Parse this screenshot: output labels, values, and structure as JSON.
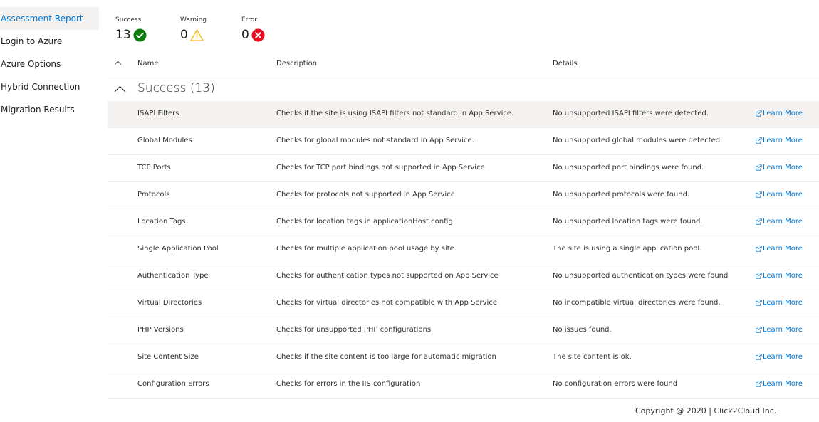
{
  "sidebar": {
    "items": [
      {
        "label": "Assessment Report",
        "active": true
      },
      {
        "label": "Login to Azure",
        "active": false
      },
      {
        "label": "Azure Options",
        "active": false
      },
      {
        "label": "Hybrid Connection",
        "active": false
      },
      {
        "label": "Migration Results",
        "active": false
      }
    ]
  },
  "summary": {
    "success": {
      "label": "Success",
      "count": "13",
      "icon": "check-circle-icon",
      "color": "#107c10"
    },
    "warning": {
      "label": "Warning",
      "count": "0",
      "icon": "warning-triangle-icon",
      "color": "#f2c12e"
    },
    "error": {
      "label": "Error",
      "count": "0",
      "icon": "error-circle-icon",
      "color": "#e81123"
    }
  },
  "table": {
    "columns": {
      "name": "Name",
      "description": "Description",
      "details": "Details"
    },
    "group": {
      "title": "Success (13)"
    },
    "link_label": "Learn More",
    "link_color": "#0078d4",
    "rows": [
      {
        "name": "ISAPI Filters",
        "description": "Checks if the site is using ISAPI filters not standard in App Service.",
        "details": "No unsupported ISAPI filters were detected."
      },
      {
        "name": "Global Modules",
        "description": "Checks for global modules not standard in App Service.",
        "details": "No unsupported global modules were detected."
      },
      {
        "name": "TCP Ports",
        "description": "Checks for TCP port bindings not supported in App Service",
        "details": "No unsupported port bindings were found."
      },
      {
        "name": "Protocols",
        "description": "Checks for protocols not supported in App Service",
        "details": "No unsupported protocols were found."
      },
      {
        "name": "Location Tags",
        "description": "Checks for location tags in applicationHost.config",
        "details": "No unsupported location tags were found."
      },
      {
        "name": "Single Application Pool",
        "description": "Checks for multiple application pool usage by site.",
        "details": "The site is using a single application pool."
      },
      {
        "name": "Authentication Type",
        "description": "Checks for authentication types not supported on App Service",
        "details": "No unsupported authentication types were found"
      },
      {
        "name": "Virtual Directories",
        "description": "Checks for virtual directories not compatible with App Service",
        "details": "No incompatible virtual directories were found."
      },
      {
        "name": "PHP Versions",
        "description": "Checks for unsupported PHP configurations",
        "details": "No issues found."
      },
      {
        "name": "Site Content Size",
        "description": "Checks if the site content is too large for automatic migration",
        "details": "The site content is ok."
      },
      {
        "name": "Configuration Errors",
        "description": "Checks for errors in the IIS configuration",
        "details": "No configuration errors were found"
      }
    ]
  },
  "footer": {
    "text": "Copyright @ 2020 |   Click2Cloud Inc."
  }
}
